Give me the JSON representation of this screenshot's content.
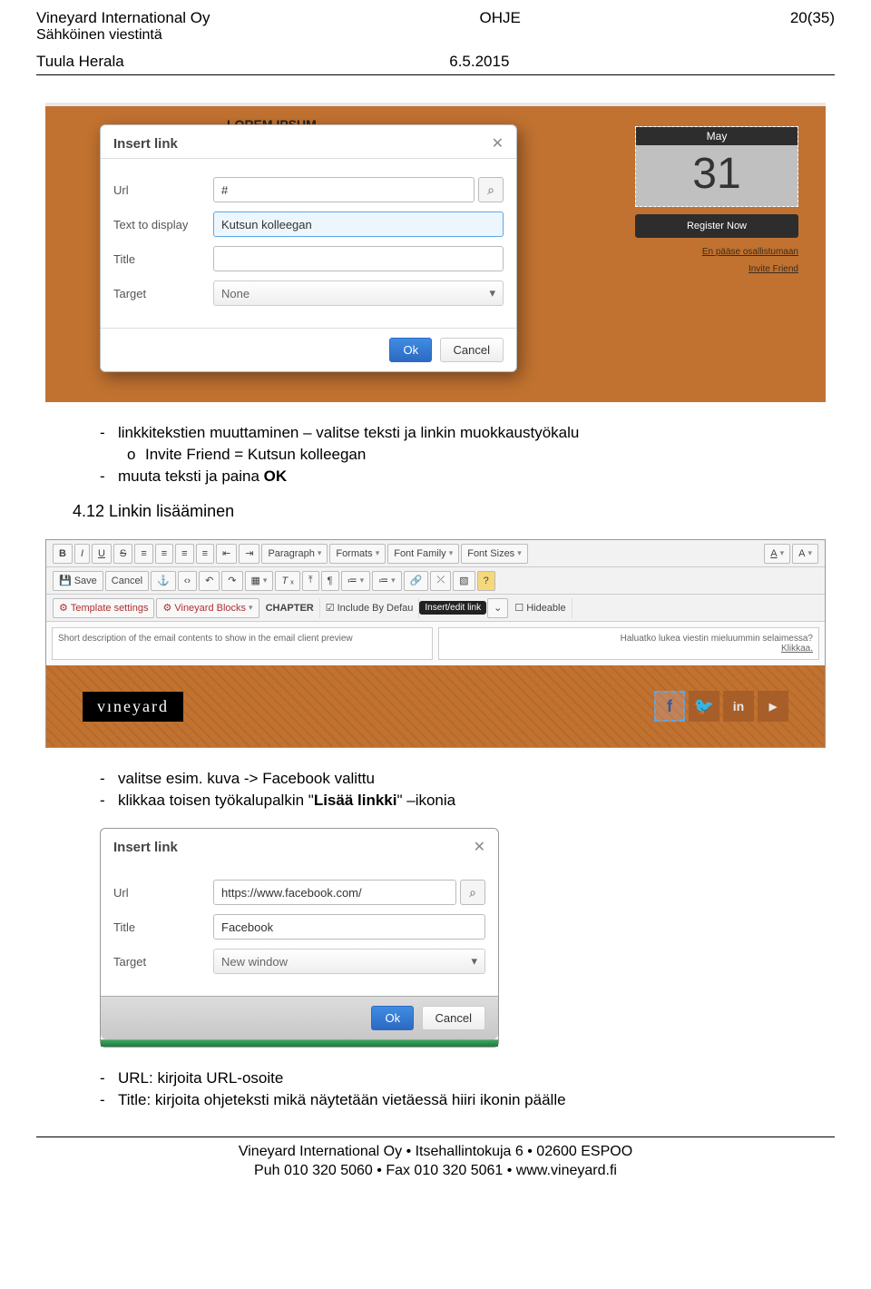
{
  "header": {
    "company": "Vineyard International Oy",
    "subtitle1": "Sähköinen viestintä",
    "author": "Tuula Herala",
    "doctype": "OHJE",
    "date": "6.5.2015",
    "page": "20(35)"
  },
  "shot1": {
    "lorem": "LOREM IPSUM",
    "modal_title": "Insert link",
    "url_label": "Url",
    "url_value": "#",
    "text_label": "Text to display",
    "text_value": "Kutsun kolleegan",
    "title_label": "Title",
    "target_label": "Target",
    "target_value": "None",
    "ok": "Ok",
    "cancel": "Cancel",
    "side": {
      "month": "May",
      "day": "31",
      "register": "Register Now",
      "line1": "En pääse osallistumaan",
      "line2": "Invite Friend"
    }
  },
  "list1": {
    "item1": "linkkitekstien muuttaminen – valitse teksti ja linkin muokkaustyökalu",
    "sub1_prefix": "Invite Friend = Kutsun kolleegan",
    "item2_prefix": "muuta teksti ja paina ",
    "item2_bold": "OK"
  },
  "section": "4.12  Linkin lisääminen",
  "toolbar": {
    "row1": {
      "par": "Paragraph",
      "formats": "Formats",
      "fontfam": "Font Family",
      "fontsz": "Font Sizes"
    },
    "row2": {
      "save": "Save",
      "cancel": "Cancel"
    },
    "row3": {
      "tpl": "Template settings",
      "blocks": "Vineyard Blocks",
      "chapter": "CHAPTER",
      "include": "Include By Defau",
      "tooltip": "Insert/edit link",
      "hideable": "Hideable"
    },
    "preview_left": "Short description of the email contents to show in the email client preview",
    "preview_right": "Haluatko lukea viestin mieluummin selaimessa?",
    "klikkaa": "Klikkaa.",
    "logo": "vıneyard"
  },
  "list2": {
    "item1": "valitse esim. kuva -> Facebook valittu",
    "item2_prefix": "klikkaa toisen työkalupalkin \"",
    "item2_bold": "Lisää linkki",
    "item2_suffix": "\" –ikonia"
  },
  "shot3": {
    "title": "Insert link",
    "url_label": "Url",
    "url_value": "https://www.facebook.com/",
    "title_label": "Title",
    "title_value": "Facebook",
    "target_label": "Target",
    "target_value": "New window",
    "ok": "Ok",
    "cancel": "Cancel"
  },
  "list3": {
    "item1": "URL: kirjoita URL-osoite",
    "item2": "Title: kirjoita ohjeteksti mikä näytetään vietäessä hiiri ikonin päälle"
  },
  "footer": {
    "line1": "Vineyard International Oy • Itsehallintokuja 6 • 02600 ESPOO",
    "line2": "Puh 010 320 5060 • Fax 010 320 5061 • www.vineyard.fi"
  }
}
